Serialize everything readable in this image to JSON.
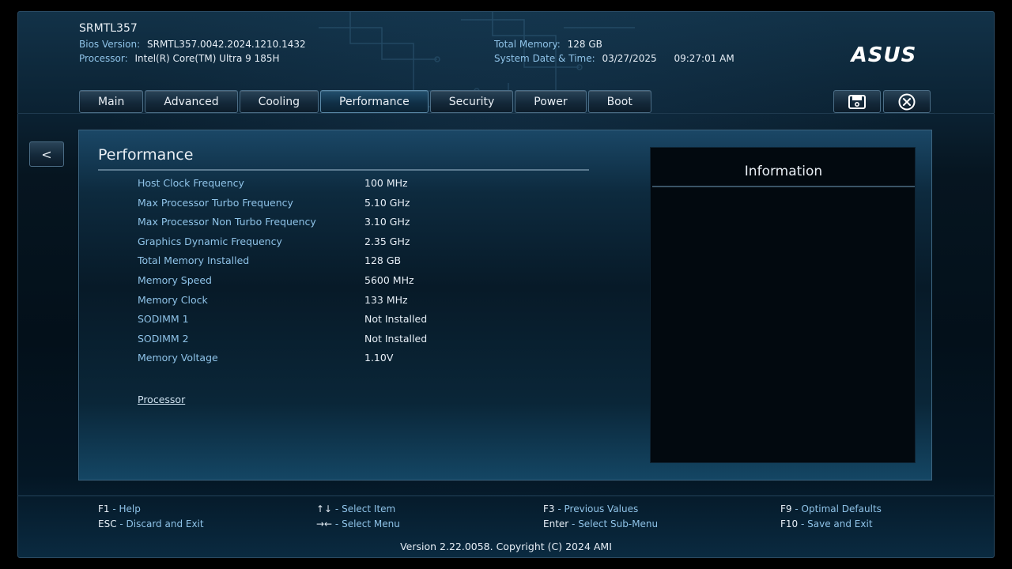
{
  "header": {
    "system_name": "SRMTL357",
    "bios_version_label": "Bios Version:",
    "bios_version_value": "SRMTL357.0042.2024.1210.1432",
    "processor_label": "Processor:",
    "processor_value": "Intel(R) Core(TM) Ultra 9 185H",
    "total_memory_label": "Total Memory:",
    "total_memory_value": "128 GB",
    "datetime_label": "System Date & Time:",
    "date_value": "03/27/2025",
    "time_value": "09:27:01 AM",
    "logo": "ASUS"
  },
  "tabs": [
    {
      "label": "Main"
    },
    {
      "label": "Advanced"
    },
    {
      "label": "Cooling"
    },
    {
      "label": "Performance",
      "active": true
    },
    {
      "label": "Security"
    },
    {
      "label": "Power"
    },
    {
      "label": "Boot"
    }
  ],
  "toolbar": {
    "save_icon": "save-icon",
    "exit_icon": "close-circle-icon"
  },
  "nav": {
    "back_label": "<"
  },
  "panel": {
    "title": "Performance",
    "settings": [
      {
        "name": "Host Clock Frequency",
        "value": "100 MHz"
      },
      {
        "name": "Max Processor Turbo Frequency",
        "value": "5.10 GHz"
      },
      {
        "name": "Max Processor Non Turbo Frequency",
        "value": "3.10 GHz"
      },
      {
        "name": "Graphics Dynamic Frequency",
        "value": "2.35 GHz"
      },
      {
        "name": "Total Memory Installed",
        "value": "128 GB"
      },
      {
        "name": "Memory Speed",
        "value": "5600 MHz"
      },
      {
        "name": "Memory Clock",
        "value": "133 MHz"
      },
      {
        "name": "SODIMM 1",
        "value": "Not Installed"
      },
      {
        "name": "SODIMM 2",
        "value": "Not Installed"
      },
      {
        "name": "Memory Voltage",
        "value": "1.10V"
      }
    ],
    "submenu_label": "Processor"
  },
  "info": {
    "title": "Information"
  },
  "footer": {
    "hotkeys": [
      {
        "key": "F1",
        "desc": "Help"
      },
      {
        "key": "ESC",
        "desc": "Discard and Exit"
      },
      {
        "key": "↑↓",
        "desc": "Select Item"
      },
      {
        "key": "→←",
        "desc": "Select Menu"
      },
      {
        "key": "F3",
        "desc": "Previous Values"
      },
      {
        "key": "Enter",
        "desc": "Select Sub-Menu"
      },
      {
        "key": "F9",
        "desc": "Optimal Defaults"
      },
      {
        "key": "F10",
        "desc": "Save and Exit"
      }
    ],
    "separator": " - ",
    "version": "Version 2.22.0058. Copyright (C) 2024 AMI"
  },
  "colors": {
    "label_blue": "#8fc3e8",
    "text_white": "#e6eef6",
    "panel_border": "#3d6580"
  }
}
